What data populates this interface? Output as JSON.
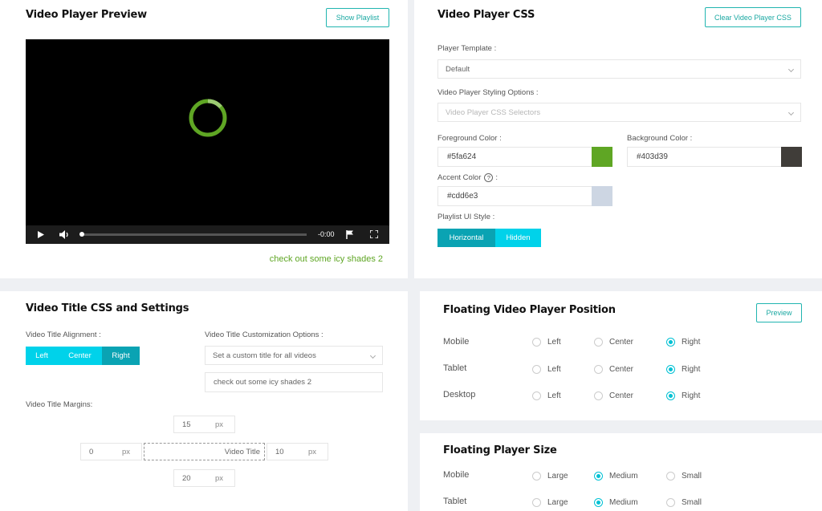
{
  "preview": {
    "title": "Video Player Preview",
    "show_playlist": "Show Playlist",
    "time": "-0:00",
    "caption": "check out some icy shades 2"
  },
  "css": {
    "title": "Video Player CSS",
    "clear_button": "Clear Video Player CSS",
    "template_label": "Player Template :",
    "template_value": "Default",
    "styling_label": "Video Player Styling Options :",
    "styling_placeholder": "Video Player CSS Selectors",
    "fg_label": "Foreground Color :",
    "fg_value": "#5fa624",
    "bg_label": "Background Color :",
    "bg_value": "#403d39",
    "accent_label": "Accent Color",
    "accent_value": "#cdd6e3",
    "accent_display": "#cdd6e3",
    "playlist_label": "Playlist UI Style :",
    "playlist_options": [
      "Horizontal",
      "Hidden"
    ]
  },
  "title_css": {
    "title": "Video Title CSS and Settings",
    "alignment_label": "Video Title Alignment :",
    "alignment_options": [
      "Left",
      "Center",
      "Right"
    ],
    "custom_label": "Video Title Customization Options :",
    "custom_select": "Set a custom title for all videos",
    "custom_value": "check out some icy shades 2",
    "margins_label": "Video Title Margins:",
    "margin_top": "15",
    "margin_left": "0",
    "margin_right": "10",
    "margin_bottom": "20",
    "unit": "px",
    "center_label": "Video Title"
  },
  "floating_position": {
    "title": "Floating Video Player Position",
    "preview_button": "Preview",
    "rows": [
      {
        "label": "Mobile",
        "options": [
          "Left",
          "Center",
          "Right"
        ],
        "selected": "Right"
      },
      {
        "label": "Tablet",
        "options": [
          "Left",
          "Center",
          "Right"
        ],
        "selected": "Right"
      },
      {
        "label": "Desktop",
        "options": [
          "Left",
          "Center",
          "Right"
        ],
        "selected": "Right"
      }
    ]
  },
  "floating_size": {
    "title": "Floating Player Size",
    "rows": [
      {
        "label": "Mobile",
        "options": [
          "Large",
          "Medium",
          "Small"
        ],
        "selected": "Medium"
      },
      {
        "label": "Tablet",
        "options": [
          "Large",
          "Medium",
          "Small"
        ],
        "selected": "Medium"
      }
    ]
  },
  "colors": {
    "accent_teal": "#21b5b0",
    "seg_active": "#0aa3b3",
    "seg_inactive": "#00d2ea",
    "spinner": "#5fa624",
    "caption": "#5fa624"
  }
}
